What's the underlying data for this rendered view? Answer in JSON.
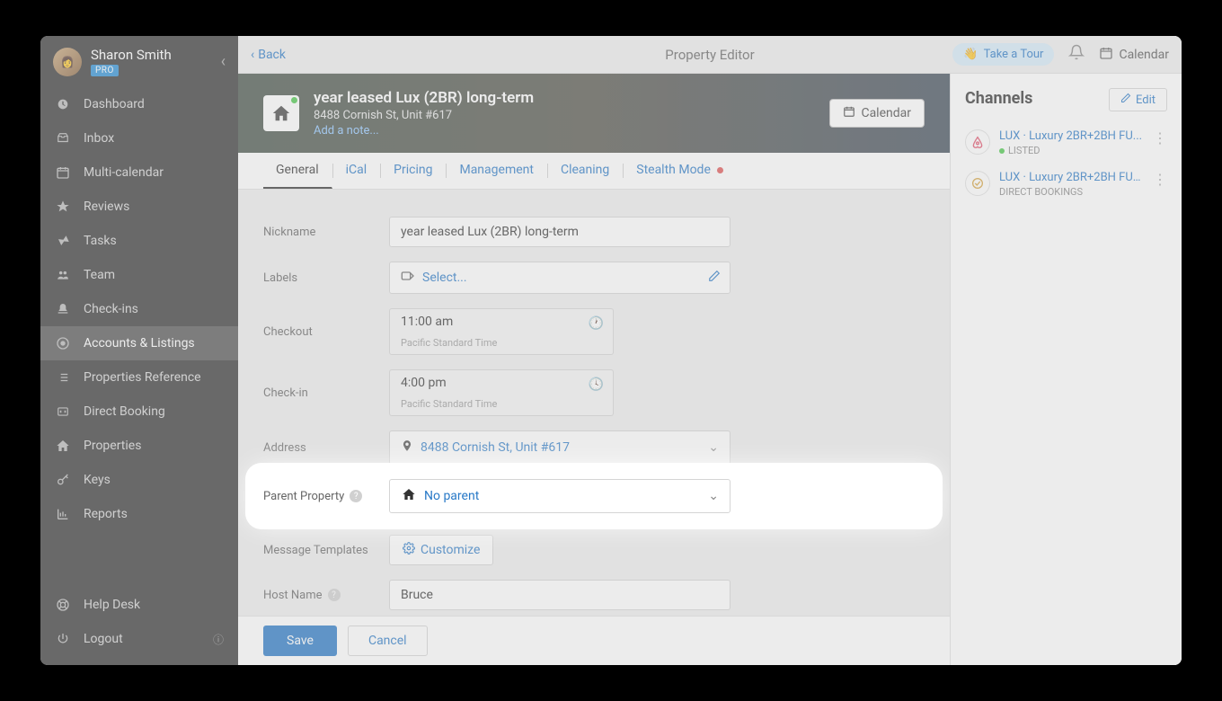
{
  "user": {
    "name": "Sharon Smith",
    "badge": "PRO"
  },
  "sidebar": {
    "items": [
      {
        "label": "Dashboard",
        "icon": "gauge"
      },
      {
        "label": "Inbox",
        "icon": "tray"
      },
      {
        "label": "Multi-calendar",
        "icon": "calendar"
      },
      {
        "label": "Reviews",
        "icon": "star"
      },
      {
        "label": "Tasks",
        "icon": "broom"
      },
      {
        "label": "Team",
        "icon": "users"
      },
      {
        "label": "Check-ins",
        "icon": "bell"
      },
      {
        "label": "Accounts & Listings",
        "icon": "target",
        "active": true
      },
      {
        "label": "Properties Reference",
        "icon": "list"
      },
      {
        "label": "Direct Booking",
        "icon": "code"
      },
      {
        "label": "Properties",
        "icon": "home"
      },
      {
        "label": "Keys",
        "icon": "key"
      },
      {
        "label": "Reports",
        "icon": "chart"
      }
    ],
    "bottom": [
      {
        "label": "Help Desk",
        "icon": "life"
      },
      {
        "label": "Logout",
        "icon": "power"
      }
    ]
  },
  "topbar": {
    "back": "Back",
    "title": "Property Editor",
    "tour": "Take a Tour",
    "calendar": "Calendar"
  },
  "hero": {
    "title": "year leased Lux (2BR) long-term",
    "address": "8488 Cornish St, Unit #617",
    "note": "Add a note...",
    "calendar_btn": "Calendar"
  },
  "tabs": [
    "General",
    "iCal",
    "Pricing",
    "Management",
    "Cleaning",
    "Stealth Mode"
  ],
  "form": {
    "nickname_label": "Nickname",
    "nickname_value": "year leased Lux  (2BR) long-term",
    "labels_label": "Labels",
    "labels_placeholder": "Select...",
    "checkout_label": "Checkout",
    "checkout_value": "11:00 am",
    "checkout_tz": "Pacific Standard Time",
    "checkin_label": "Check-in",
    "checkin_value": "4:00 pm",
    "checkin_tz": "Pacific Standard Time",
    "address_label": "Address",
    "address_value": "8488 Cornish St, Unit #617",
    "parent_label": "Parent Property",
    "parent_value": "No parent",
    "msgtpl_label": "Message Templates",
    "customize_btn": "Customize",
    "host_label": "Host Name",
    "host_value": "Bruce",
    "save": "Save",
    "cancel": "Cancel"
  },
  "channels": {
    "heading": "Channels",
    "edit": "Edit",
    "items": [
      {
        "title": "LUX · Luxury 2BR+2BH FU...",
        "sub": "LISTED",
        "icon": "airbnb",
        "listed": true
      },
      {
        "title": "LUX · Luxury 2BR+2BH FURN...",
        "sub": "DIRECT BOOKINGS",
        "icon": "direct",
        "listed": false
      }
    ]
  }
}
